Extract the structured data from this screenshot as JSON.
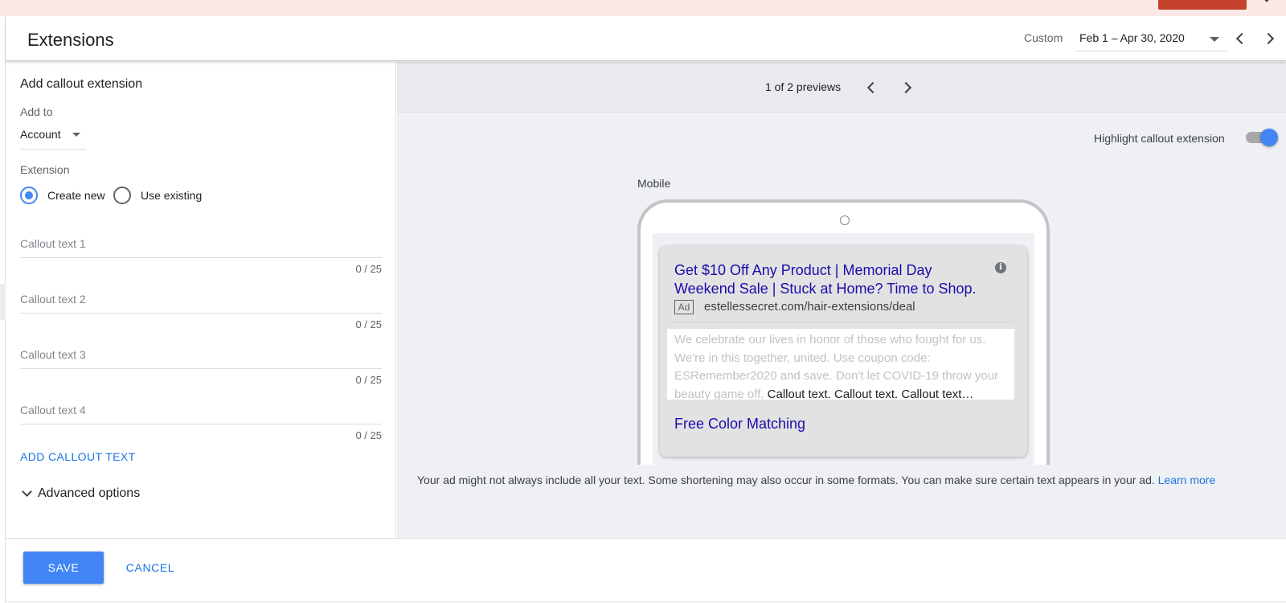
{
  "header": {
    "title": "Extensions",
    "date_range_label": "Custom",
    "date_range_value": "Feb 1 – Apr 30, 2020",
    "icons": {
      "prev": "chevron-left-icon",
      "next": "chevron-right-icon",
      "dropdown": "caret-down-icon"
    }
  },
  "form": {
    "title": "Add callout extension",
    "add_to_label": "Add to",
    "add_to_value": "Account",
    "extension_label": "Extension",
    "radio_create_new": "Create new",
    "radio_use_existing": "Use existing",
    "selected_radio": "create_new",
    "callout_fields": [
      {
        "placeholder": "Callout text 1",
        "counter": "0 / 25"
      },
      {
        "placeholder": "Callout text 2",
        "counter": "0 / 25"
      },
      {
        "placeholder": "Callout text 3",
        "counter": "0 / 25"
      },
      {
        "placeholder": "Callout text 4",
        "counter": "0 / 25"
      }
    ],
    "add_callout_link": "ADD CALLOUT TEXT",
    "advanced_options": "Advanced options"
  },
  "preview": {
    "count_text": "1 of 2 previews",
    "highlight_label": "Highlight callout extension",
    "highlight_on": true,
    "device_label": "Mobile",
    "ad": {
      "headline": "Get $10 Off Any Product | Memorial Day Weekend Sale | Stuck at Home? Time to Shop.",
      "badge": "Ad",
      "url": "estellessecret.com/hair-extensions/deal",
      "description": "We celebrate our lives in honor of those who fought for us. We're in this together, united. Use coupon code: ESRemember2020 and save. Don't let COVID-19 throw your beauty game off.",
      "callout_preview": "Callout text. Callout text. Callout text…",
      "extension": "Free Color Matching",
      "info_icon": "info-icon"
    },
    "disclaimer": "Your ad might not always include all your text. Some shortening may also occur in some formats. You can make sure certain text appears in your ad.",
    "learn_more": "Learn more"
  },
  "footer": {
    "save": "SAVE",
    "cancel": "CANCEL"
  },
  "colors": {
    "accent": "#4285f4",
    "link": "#1a73e8",
    "ad_link": "#1a0dab",
    "banner": "#fce8e6"
  }
}
